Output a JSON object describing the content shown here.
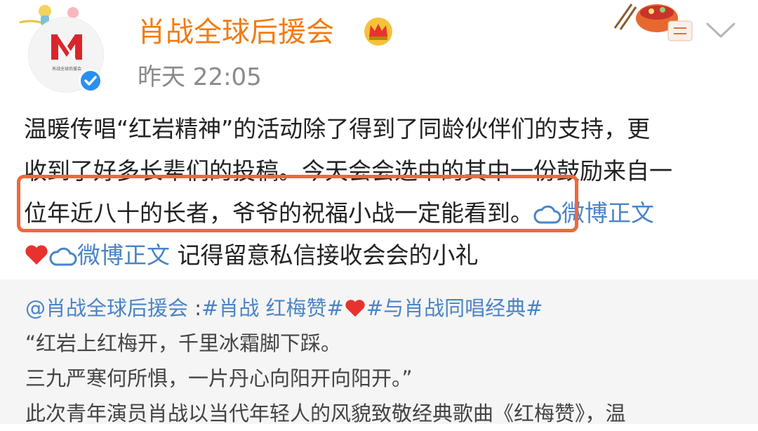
{
  "post": {
    "username": "肖战全球后援会",
    "timestamp": "昨天 22:05",
    "avatar_caption": "肖战全球后援会",
    "body": {
      "line1": "温暖传唱“红岩精神”的活动除了得到了同龄伙伴们的支持，更",
      "line2": "收到了好多长辈们的投稿。今天会会选中的其中一份鼓励来自一",
      "line3": "位年近八十的长者，爷爷的祝福小战一定能看到。",
      "link1": "微博正文",
      "link2": "微博正文",
      "line4_tail": " 记得留意私信接收会会的小礼"
    }
  },
  "repost": {
    "mention": "@肖战全球后援会",
    "sep": " :",
    "hashtag1": "#肖战 红梅赞#",
    "hashtag2": "#与肖战同唱经典#",
    "line2": "“红岩上红梅开，千里冰霜脚下踩。",
    "line3": "三九严寒何所惧，一片丹心向阳开向阳开。”",
    "line4": "此次青年演员肖战以当代年轻人的风貌致敬经典歌曲《红梅赞》，温"
  },
  "colors": {
    "username": "#f07c14",
    "link": "#4a84c6",
    "highlight": "#f4663a",
    "verified": "#2b8ff0",
    "heart": "#e8322e"
  },
  "icons": [
    "prince-deco-icon",
    "avatar-logo-icon",
    "verified-badge-icon",
    "crown-icon",
    "food-deco-icon",
    "chevron-down-icon",
    "cloud-link-icon",
    "heart-icon"
  ]
}
